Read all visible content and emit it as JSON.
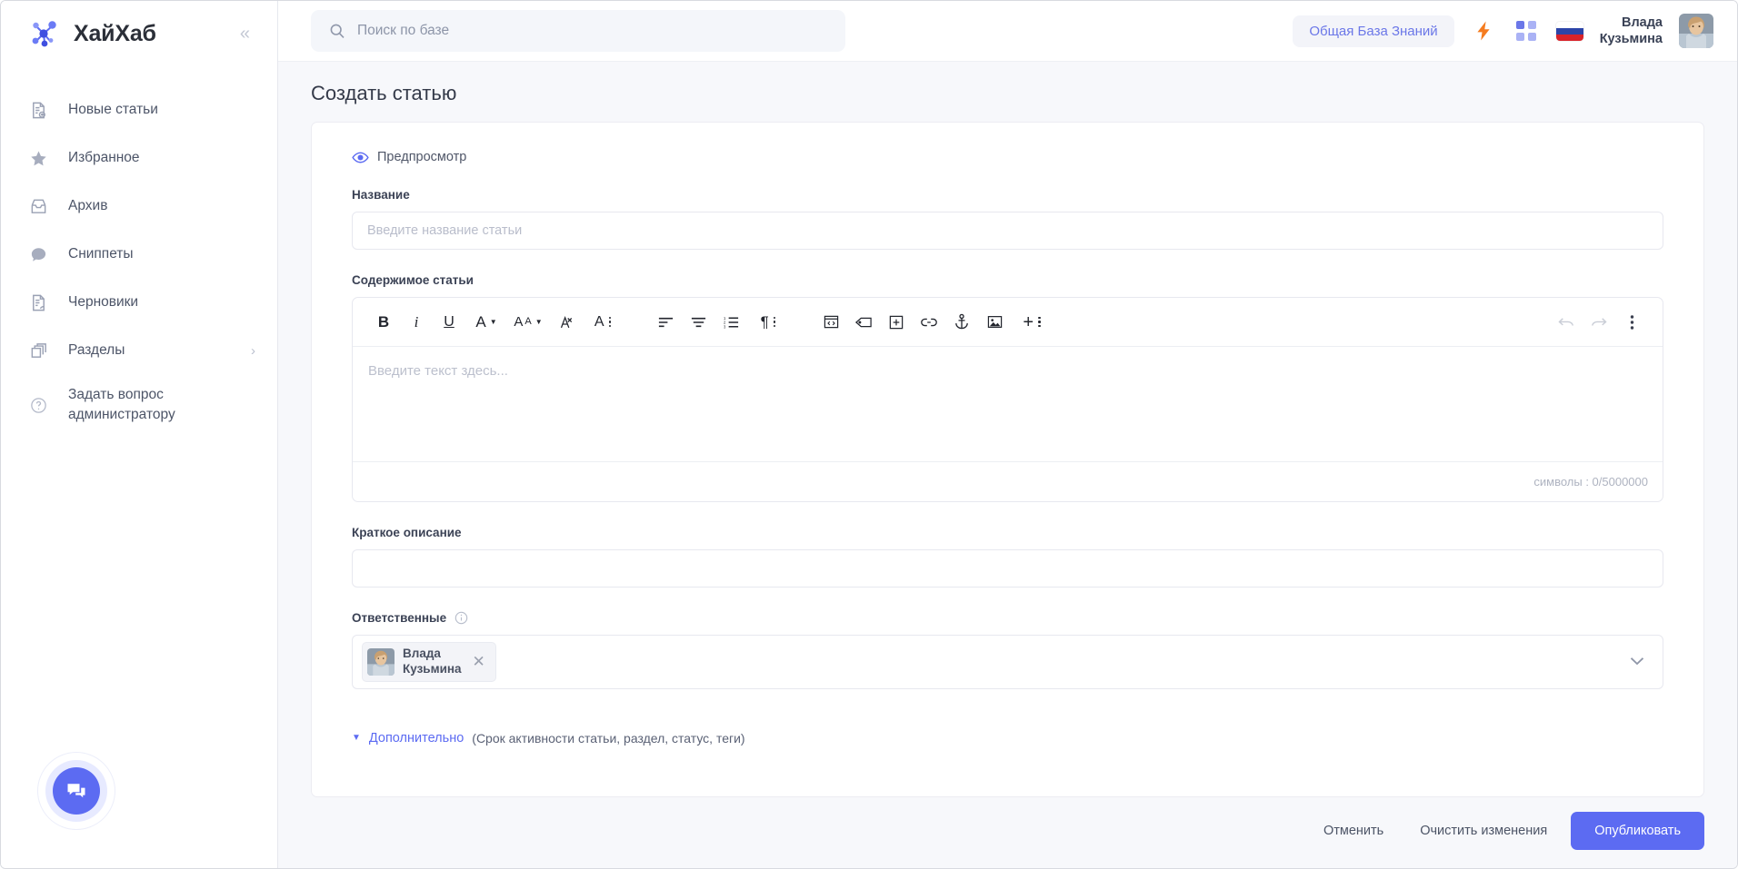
{
  "brand": {
    "name": "ХайХаб",
    "collapse_label": "«",
    "logo_icon": "network-nodes-icon"
  },
  "sidebar": {
    "items": [
      {
        "label": "Новые статьи",
        "icon": "document-add-icon",
        "chevron": ""
      },
      {
        "label": "Избранное",
        "icon": "star-icon",
        "chevron": ""
      },
      {
        "label": "Архив",
        "icon": "archive-box-icon",
        "chevron": ""
      },
      {
        "label": "Сниппеты",
        "icon": "speech-bubble-icon",
        "chevron": ""
      },
      {
        "label": "Черновики",
        "icon": "document-draft-icon",
        "chevron": ""
      },
      {
        "label": "Разделы",
        "icon": "layers-icon",
        "chevron": "›"
      },
      {
        "label": "Задать вопрос администратору",
        "icon": "question-circle-icon",
        "chevron": ""
      }
    ],
    "chat_fab_icon": "chat-bubbles-icon"
  },
  "topbar": {
    "search": {
      "placeholder": "Поиск по базе",
      "value": "",
      "icon": "search-icon"
    },
    "knowledge_base_chip": "Общая База Знаний",
    "bolt_icon": "lightning-bolt-icon",
    "apps_icon": "grid-apps-icon",
    "language_flag": "ru-flag-icon",
    "user": {
      "name_line1": "Влада",
      "name_line2": "Кузьмина",
      "avatar_icon": "user-avatar"
    }
  },
  "page": {
    "title": "Создать статью"
  },
  "form": {
    "preview": {
      "label": "Предпросмотр",
      "icon": "eye-icon"
    },
    "title_field": {
      "label": "Название",
      "placeholder": "Введите название статьи",
      "value": ""
    },
    "content_field": {
      "label": "Содержимое статьи",
      "placeholder": "Введите текст здесь...",
      "value": "",
      "counter": "символы : 0/5000000"
    },
    "description_field": {
      "label": "Краткое описание",
      "placeholder": "",
      "value": ""
    },
    "responsible_field": {
      "label": "Ответственные",
      "info_icon": "info-circle-icon",
      "chevron_icon": "chevron-down-icon",
      "chips": [
        {
          "name_line1": "Влада",
          "name_line2": "Кузьмина",
          "remove_label": "✕"
        }
      ]
    },
    "extra": {
      "caret": "▼",
      "link": "Дополнительно",
      "hint": "(Срок активности статьи, раздел, статус, теги)"
    }
  },
  "toolbar": {
    "groups": [
      [
        {
          "icon": "bold-icon",
          "glyph": "B",
          "style": "bold"
        },
        {
          "icon": "italic-icon",
          "glyph": "i",
          "style": "italic"
        },
        {
          "icon": "underline-icon",
          "glyph": "U",
          "style": "underline"
        },
        {
          "icon": "font-color-icon",
          "glyph": "A",
          "style": "caret"
        },
        {
          "icon": "font-size-icon",
          "glyph": "Aa",
          "style": "caret"
        },
        {
          "icon": "clear-format-icon",
          "glyph": "",
          "style": "svg"
        },
        {
          "icon": "line-height-icon",
          "glyph": "A",
          "style": "dots"
        }
      ],
      [
        {
          "icon": "align-left-icon",
          "glyph": "",
          "style": "svg"
        },
        {
          "icon": "align-center-icon",
          "glyph": "",
          "style": "svg"
        },
        {
          "icon": "ordered-list-icon",
          "glyph": "",
          "style": "svg"
        },
        {
          "icon": "paragraph-icon",
          "glyph": "¶",
          "style": "dots"
        }
      ],
      [
        {
          "icon": "code-block-icon",
          "glyph": "",
          "style": "svg"
        },
        {
          "icon": "tag-icon",
          "glyph": "",
          "style": "svg"
        },
        {
          "icon": "insert-box-icon",
          "glyph": "",
          "style": "svg"
        },
        {
          "icon": "link-icon",
          "glyph": "",
          "style": "svg"
        },
        {
          "icon": "anchor-icon",
          "glyph": "",
          "style": "svg"
        },
        {
          "icon": "image-icon",
          "glyph": "",
          "style": "svg"
        },
        {
          "icon": "insert-more-icon",
          "glyph": "+",
          "style": "dots"
        }
      ]
    ],
    "right": [
      {
        "icon": "undo-icon"
      },
      {
        "icon": "redo-icon"
      },
      {
        "icon": "kebab-menu-icon"
      }
    ]
  },
  "actions": {
    "cancel": "Отменить",
    "clear": "Очистить изменения",
    "publish": "Опубликовать"
  },
  "colors": {
    "accent": "#5c6bf2",
    "link": "#6b77e8",
    "bolt": "#f57c1f",
    "text": "#3b4255",
    "muted": "#9aa1b4",
    "page_bg": "#f7f8fb"
  }
}
